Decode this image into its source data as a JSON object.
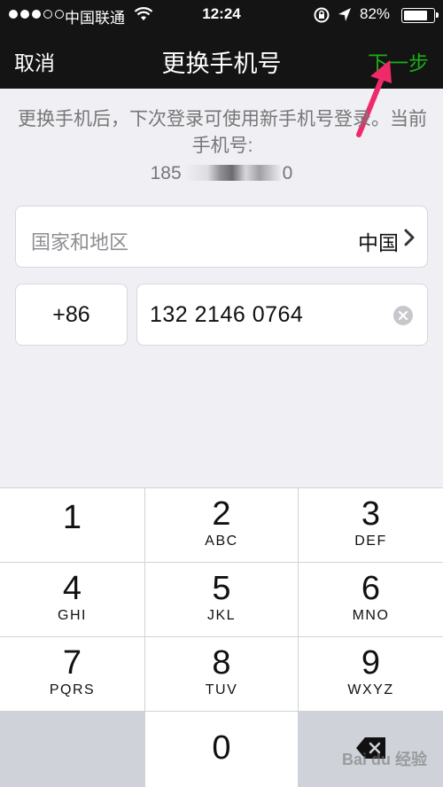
{
  "status_bar": {
    "carrier": "中国联通",
    "time": "12:24",
    "battery_pct": "82%",
    "battery_level": 0.82
  },
  "nav": {
    "cancel_label": "取消",
    "title": "更换手机号",
    "next_label": "下一步"
  },
  "content": {
    "description": "更换手机后，下次登录可使用新手机号登录。当前手机号:",
    "current_phone_prefix": "185",
    "current_phone_suffix": "0"
  },
  "form": {
    "region_label": "国家和地区",
    "region_value": "中国",
    "country_code": "+86",
    "phone_value": "132 2146 0764"
  },
  "keypad": {
    "keys": [
      {
        "num": "1",
        "letters": ""
      },
      {
        "num": "2",
        "letters": "ABC"
      },
      {
        "num": "3",
        "letters": "DEF"
      },
      {
        "num": "4",
        "letters": "GHI"
      },
      {
        "num": "5",
        "letters": "JKL"
      },
      {
        "num": "6",
        "letters": "MNO"
      },
      {
        "num": "7",
        "letters": "PQRS"
      },
      {
        "num": "8",
        "letters": "TUV"
      },
      {
        "num": "9",
        "letters": "WXYZ"
      },
      {
        "num": "0",
        "letters": ""
      }
    ]
  },
  "watermark": "Bai du 经验",
  "colors": {
    "nav_bg": "#141414",
    "accent_green": "#1aad19",
    "annotation_pink": "#ee2a6a",
    "page_bg": "#efeff4"
  },
  "icons": [
    "wifi-icon",
    "rotation-lock-icon",
    "location-arrow-icon",
    "battery-icon",
    "chevron-right-icon",
    "clear-icon",
    "backspace-icon",
    "annotation-arrow-icon"
  ]
}
